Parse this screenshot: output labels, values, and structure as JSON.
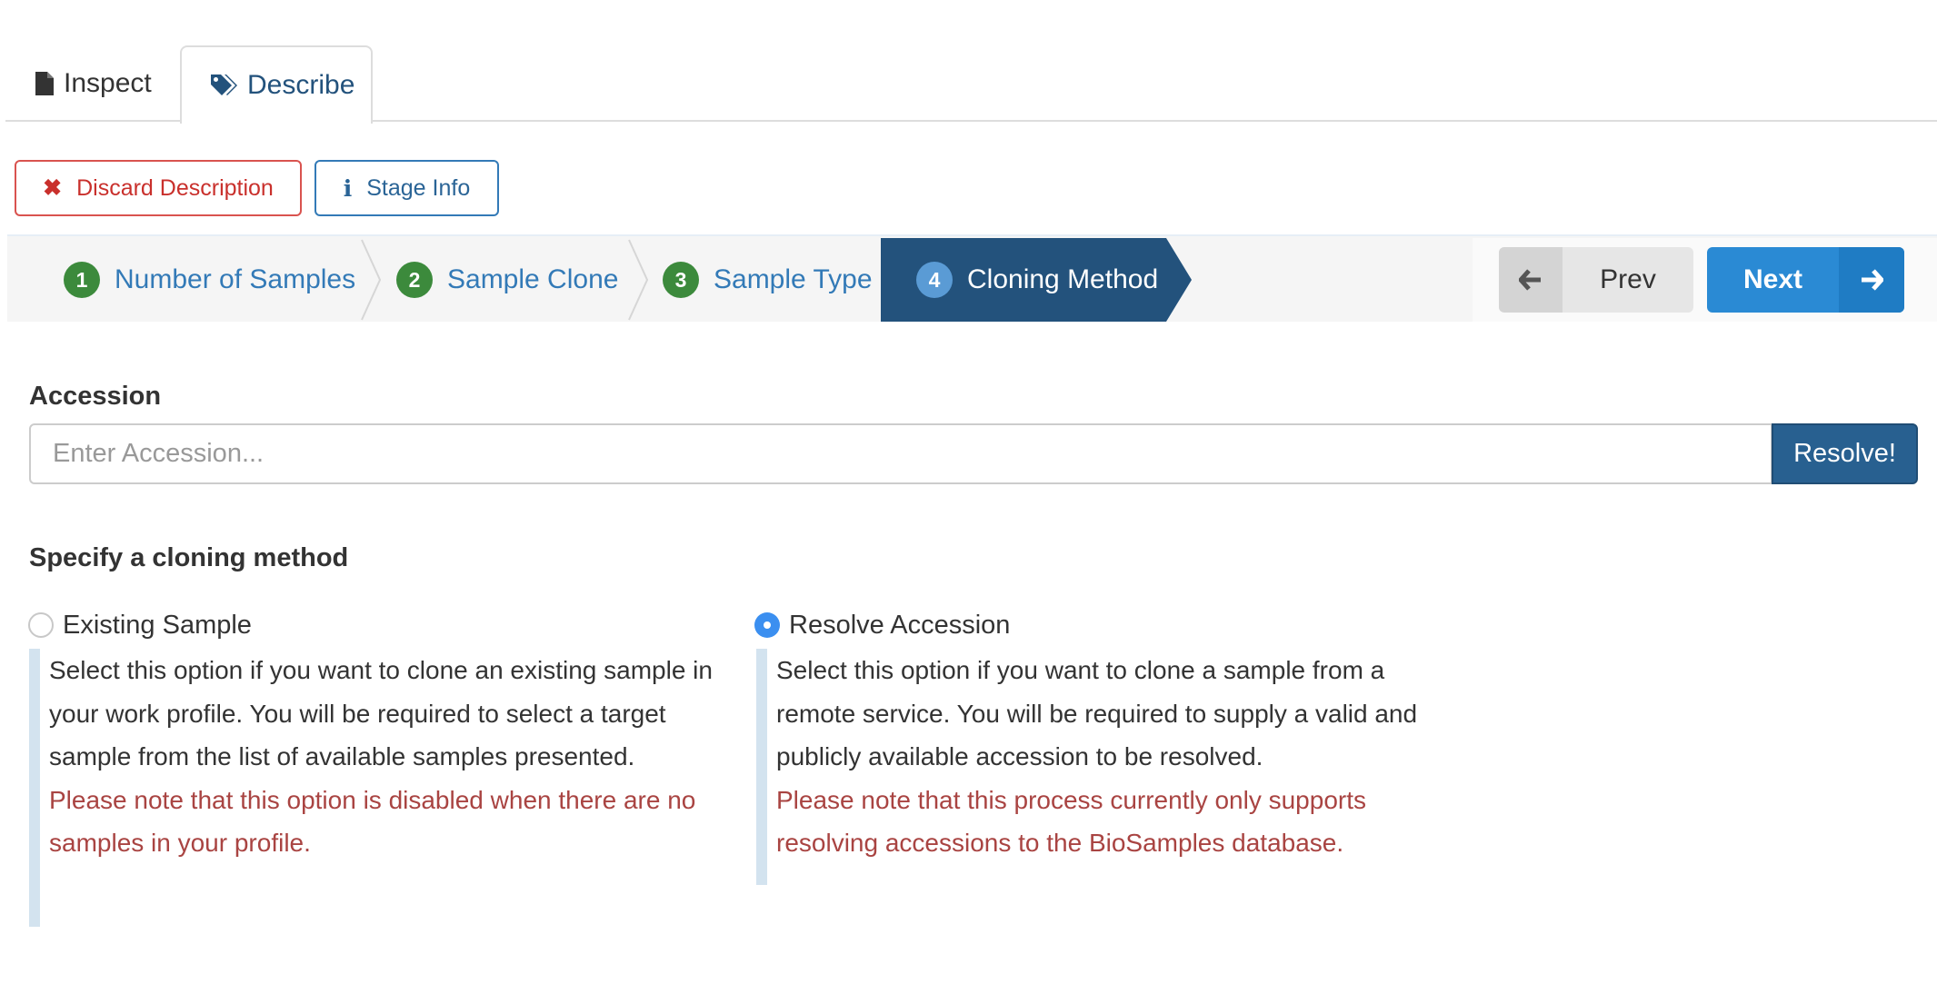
{
  "tabs": [
    {
      "label": "Inspect",
      "icon": "file-icon",
      "active": false
    },
    {
      "label": "Describe",
      "icon": "tags-icon",
      "active": true
    }
  ],
  "actions": {
    "discard_label": "Discard Description",
    "stage_info_label": "Stage Info"
  },
  "wizard": {
    "steps": [
      {
        "number": "1",
        "label": "Number of Samples"
      },
      {
        "number": "2",
        "label": "Sample Clone"
      },
      {
        "number": "3",
        "label": "Sample Type"
      },
      {
        "number": "4",
        "label": "Cloning Method"
      }
    ],
    "active_step": 4,
    "prev_label": "Prev",
    "next_label": "Next"
  },
  "accession": {
    "label": "Accession",
    "placeholder": "Enter Accession...",
    "value": "",
    "resolve_label": "Resolve!"
  },
  "cloning": {
    "heading": "Specify a cloning method",
    "options": [
      {
        "label": "Existing Sample",
        "selected": false,
        "description": "Select this option if you want to clone an existing sample in your work profile. You will be required to select a target sample from the list of available samples presented.",
        "warning": "Please note that this option is disabled when there are no samples in your profile."
      },
      {
        "label": "Resolve Accession",
        "selected": true,
        "description": "Select this option if you want to clone a sample from a remote service. You will be required to supply a valid and publicly available accession to be resolved.",
        "warning": "Please note that this process currently only supports resolving accessions to the BioSamples database."
      }
    ]
  },
  "colors": {
    "primary": "#337ab7",
    "active_step": "#23527c",
    "danger": "#d9534f",
    "step_number": "#3c8a3c",
    "next_button": "#2a8ad4",
    "warning_text": "#a94442"
  }
}
